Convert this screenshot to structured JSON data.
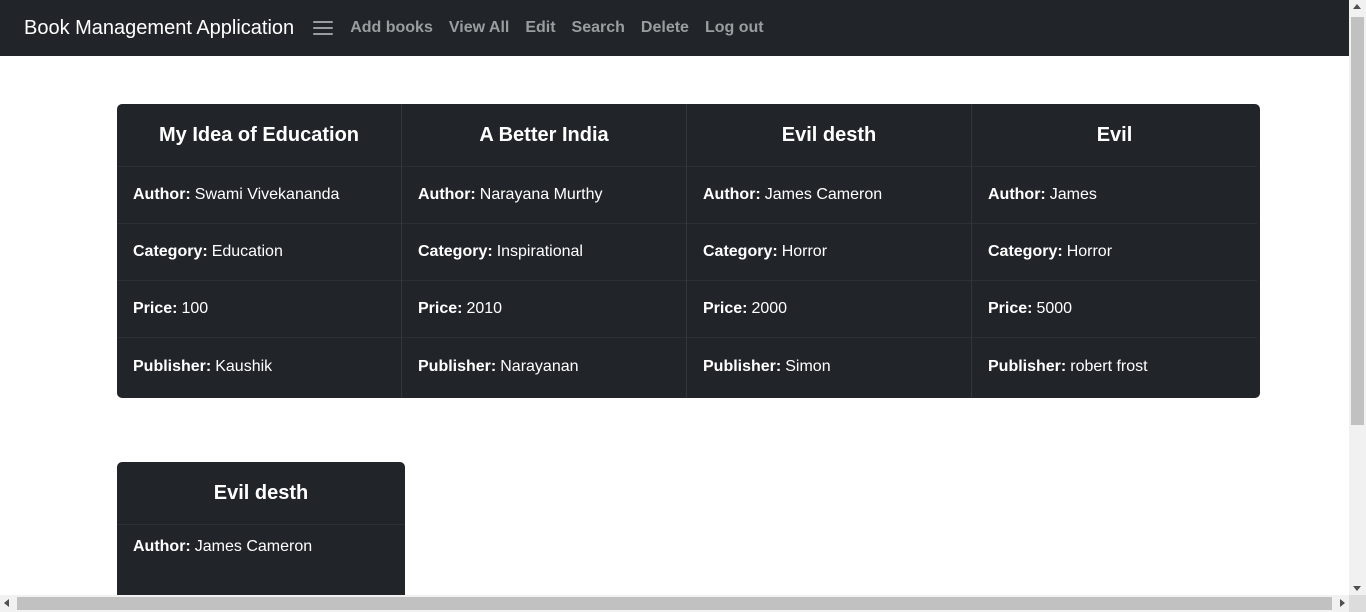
{
  "app": {
    "title": "Book Management Application"
  },
  "nav": {
    "menu_icon": "hamburger-menu-icon",
    "links": [
      "Add books",
      "View All",
      "Edit",
      "Search",
      "Delete",
      "Log out"
    ]
  },
  "labels": {
    "author": "Author:",
    "category": "Category:",
    "price": "Price:",
    "publisher": "Publisher:"
  },
  "books": [
    {
      "title": "My Idea of Education",
      "author": "Swami Vivekananda",
      "category": "Education",
      "price": "100",
      "publisher": "Kaushik"
    },
    {
      "title": "A Better India",
      "author": "Narayana Murthy",
      "category": "Inspirational",
      "price": "2010",
      "publisher": "Narayanan"
    },
    {
      "title": "Evil desth",
      "author": "James Cameron",
      "category": "Horror",
      "price": "2000",
      "publisher": "Simon"
    },
    {
      "title": "Evil",
      "author": "James",
      "category": "Horror",
      "price": "5000",
      "publisher": "robert frost"
    },
    {
      "title": "Evil desth",
      "author": "James Cameron"
    }
  ],
  "colors": {
    "navbar": "#212529",
    "card": "#212529",
    "nav_link": "#9a9da0",
    "text": "#ffffff"
  }
}
